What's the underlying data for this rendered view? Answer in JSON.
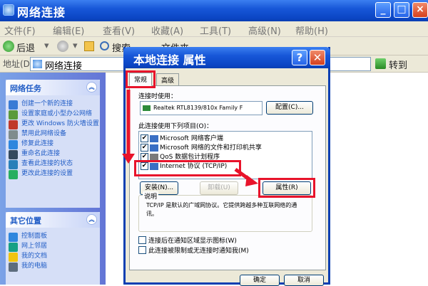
{
  "window": {
    "title": "网络连接",
    "menu": [
      "文件(F)",
      "编辑(E)",
      "查看(V)",
      "收藏(A)",
      "工具(T)",
      "高级(N)",
      "帮助(H)"
    ],
    "toolbar": {
      "back": "后退",
      "search": "搜索",
      "folders": "文件夹"
    },
    "address": {
      "label": "地址(D)",
      "value": "网络连接",
      "go": "转到"
    }
  },
  "sidebar": {
    "network_tasks": {
      "title": "网络任务",
      "items": [
        {
          "label": "创建一个新的连接",
          "icon": "new-connection-icon",
          "color": "#3a7bd5"
        },
        {
          "label": "设置家庭或小型办公网络",
          "icon": "home-network-icon",
          "color": "#5a9a3a"
        },
        {
          "label": "更改 Windows 防火墙设置",
          "icon": "firewall-icon",
          "color": "#c0392b"
        },
        {
          "label": "禁用此网络设备",
          "icon": "disable-icon",
          "color": "#7f8c8d"
        },
        {
          "label": "修复此连接",
          "icon": "repair-icon",
          "color": "#2e86de"
        },
        {
          "label": "重命名此连接",
          "icon": "rename-icon",
          "color": "#34495e"
        },
        {
          "label": "查看此连接的状态",
          "icon": "status-icon",
          "color": "#2980b9"
        },
        {
          "label": "更改此连接的设置",
          "icon": "settings-icon",
          "color": "#27ae60"
        }
      ]
    },
    "other_places": {
      "title": "其它位置",
      "items": [
        {
          "label": "控制面板",
          "icon": "control-panel-icon",
          "color": "#2e86de"
        },
        {
          "label": "网上邻居",
          "icon": "network-places-icon",
          "color": "#16a085"
        },
        {
          "label": "我的文档",
          "icon": "my-documents-icon",
          "color": "#f1c40f"
        },
        {
          "label": "我的电脑",
          "icon": "my-computer-icon",
          "color": "#5d6d7e"
        }
      ]
    }
  },
  "dialog": {
    "title": "本地连接 属性",
    "tabs": [
      "常规",
      "高级"
    ],
    "connect_using_label": "连接时使用：",
    "adapter": "Realtek RTL8139/810x Family F",
    "configure_button": "配置(C)...",
    "items_label": "此连接使用下列项目(O)：",
    "items": [
      {
        "label": "Microsoft 网络客户端",
        "checked": true
      },
      {
        "label": "Microsoft 网络的文件和打印机共享",
        "checked": true
      },
      {
        "label": "QoS 数据包计划程序",
        "checked": true
      },
      {
        "label": "Internet 协议 (TCP/IP)",
        "checked": true
      }
    ],
    "install_button": "安装(N)...",
    "uninstall_button": "卸载(U)",
    "properties_button": "属性(R)",
    "description_title": "说明",
    "description": "TCP/IP 是默认的广域网协议。它提供跨越多种互联网络的通讯。",
    "show_icon_label": "连接后在通知区域显示图标(W)",
    "notify_label": "此连接被限制或无连接时通知我(M)",
    "ok_button": "确定",
    "cancel_button": "取消",
    "accent_color": "#e8132b"
  }
}
